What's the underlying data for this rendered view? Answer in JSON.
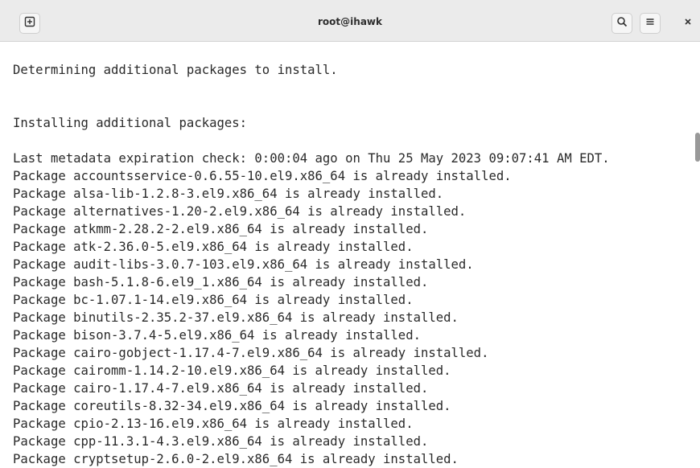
{
  "window": {
    "title": "root@ihawk"
  },
  "icons": {
    "new_tab": "new-tab-icon",
    "search": "search-icon",
    "menu": "hamburger-menu-icon",
    "close": "close-icon"
  },
  "terminal": {
    "lines": [
      "Determining additional packages to install.",
      "Installing additional packages:",
      "Last metadata expiration check: 0:00:04 ago on Thu 25 May 2023 09:07:41 AM EDT.",
      "Package accountsservice-0.6.55-10.el9.x86_64 is already installed.",
      "Package alsa-lib-1.2.8-3.el9.x86_64 is already installed.",
      "Package alternatives-1.20-2.el9.x86_64 is already installed.",
      "Package atkmm-2.28.2-2.el9.x86_64 is already installed.",
      "Package atk-2.36.0-5.el9.x86_64 is already installed.",
      "Package audit-libs-3.0.7-103.el9.x86_64 is already installed.",
      "Package bash-5.1.8-6.el9_1.x86_64 is already installed.",
      "Package bc-1.07.1-14.el9.x86_64 is already installed.",
      "Package binutils-2.35.2-37.el9.x86_64 is already installed.",
      "Package bison-3.7.4-5.el9.x86_64 is already installed.",
      "Package cairo-gobject-1.17.4-7.el9.x86_64 is already installed.",
      "Package cairomm-1.14.2-10.el9.x86_64 is already installed.",
      "Package cairo-1.17.4-7.el9.x86_64 is already installed.",
      "Package coreutils-8.32-34.el9.x86_64 is already installed.",
      "Package cpio-2.13-16.el9.x86_64 is already installed.",
      "Package cpp-11.3.1-4.3.el9.x86_64 is already installed.",
      "Package cryptsetup-2.6.0-2.el9.x86_64 is already installed."
    ]
  }
}
